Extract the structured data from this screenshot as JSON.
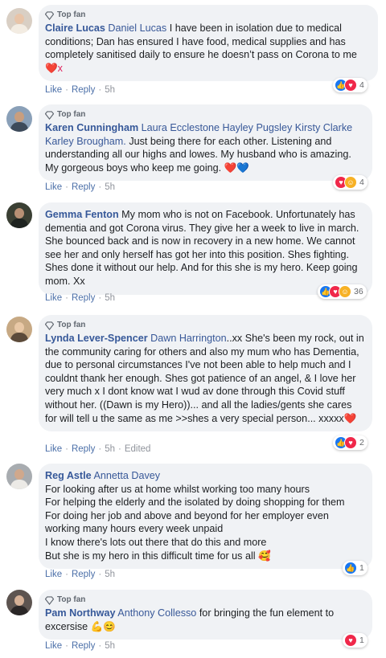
{
  "comments": [
    {
      "top_fan": "Top fan",
      "author": "Claire Lucas",
      "mentions": "Daniel Lucas",
      "text": "I have been in isolation due to medical conditions; Dan has ensured I have food, medical supplies and has completely sanitised daily to ensure he doesn’t pass on Corona to me",
      "emoji": "❤️x",
      "like": "Like",
      "reply": "Reply",
      "time": "5h",
      "reaction_count": "4",
      "reactions": [
        "like",
        "love"
      ]
    },
    {
      "top_fan": "Top fan",
      "author": "Karen Cunningham",
      "mentions": "Laura Ecclestone Hayley Pugsley Kirsty Clarke Karley Brougham.",
      "text": "Just being there for each other. Listening and understanding all our highs and lowes. My husband who is amazing. My gorgeous boys who keep me going.",
      "emoji": "❤️💙",
      "like": "Like",
      "reply": "Reply",
      "time": "5h",
      "reaction_count": "4",
      "reactions": [
        "love",
        "care"
      ]
    },
    {
      "author": "Gemma Fenton",
      "text": "My mom who is not on Facebook. Unfortunately has dementia and got Corona virus. They give her a week to live in march. She bounced back and is now in recovery in a new home. We cannot see her and only herself has got her into this position. Shes fighting. Shes done it without our help. And for this she is my hero. Keep going mom. Xx",
      "like": "Like",
      "reply": "Reply",
      "time": "5h",
      "reaction_count": "36",
      "reactions": [
        "like",
        "love",
        "care"
      ]
    },
    {
      "top_fan": "Top fan",
      "author": "Lynda Lever-Spencer",
      "mentions": "Dawn Harrington",
      "text": "..xx She's been my rock, out in the community caring for others and also my mum who has Dementia, due to personal circumstances I've not been able to help much and I couldnt thank her enough. Shes got patience of an angel, & I love her very much x I dont know wat I wud av done through this Covid stuff without her. ((Dawn is my Hero))... and all the ladies/gents she cares for will tell u the same as me >>shes a very special person... xxxxx",
      "emoji": "❤️",
      "like": "Like",
      "reply": "Reply",
      "time": "5h",
      "edited": "Edited",
      "reaction_count": "2",
      "reactions": [
        "like",
        "love"
      ]
    },
    {
      "author": "Reg Astle",
      "mentions": "Annetta Davey",
      "lines": [
        "For looking after us at home whilst working too many hours",
        "For helping the elderly and the isolated by doing shopping for them",
        "For doing her job and above and beyond for her employer even working many hours every week unpaid",
        "I know there's lots out there that do this and more",
        "But she is my hero in this difficult time for us all 🥰"
      ],
      "like": "Like",
      "reply": "Reply",
      "time": "5h",
      "reaction_count": "1",
      "reactions": [
        "like"
      ]
    },
    {
      "top_fan": "Top fan",
      "author": "Pam Northway",
      "mentions": "Anthony Collesso",
      "text": "for bringing the fun element to excersise",
      "emoji": "💪😊",
      "like": "Like",
      "reply": "Reply",
      "time": "5h",
      "reaction_count": "1",
      "reactions": [
        "love"
      ]
    }
  ],
  "colors": {
    "link": "#365899",
    "bubble": "#f0f2f5",
    "like_blue": "#1877f2",
    "love_red": "#f0284a",
    "care_yellow": "#f7b125"
  }
}
